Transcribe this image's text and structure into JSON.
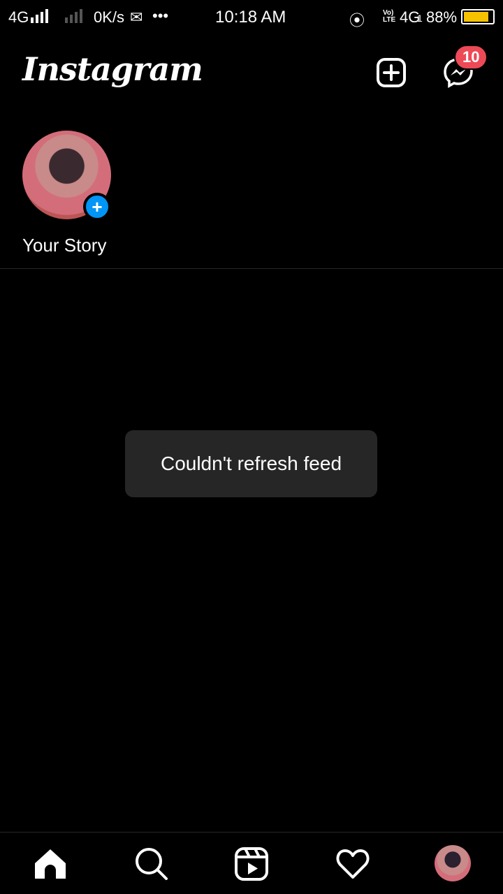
{
  "status_bar": {
    "network_left": "4G",
    "speed": "0K/s",
    "more": "•••",
    "time": "10:18 AM",
    "volte": "Vo) LTE",
    "network_right": "4G",
    "sim": "1",
    "battery_percent": "88%",
    "battery_level": 88,
    "battery_color": "#f7c200"
  },
  "header": {
    "logo": "Instagram",
    "new_post_icon": "plus-square-icon",
    "messenger_icon": "messenger-icon",
    "messages_badge": "10",
    "badge_color": "#ed4956"
  },
  "stories": [
    {
      "label": "Your Story",
      "add_icon": "+"
    }
  ],
  "toast": {
    "text": "Couldn't refresh feed"
  },
  "bottom_nav": {
    "items": [
      "home-icon",
      "search-icon",
      "reels-icon",
      "heart-icon",
      "profile-avatar"
    ]
  }
}
